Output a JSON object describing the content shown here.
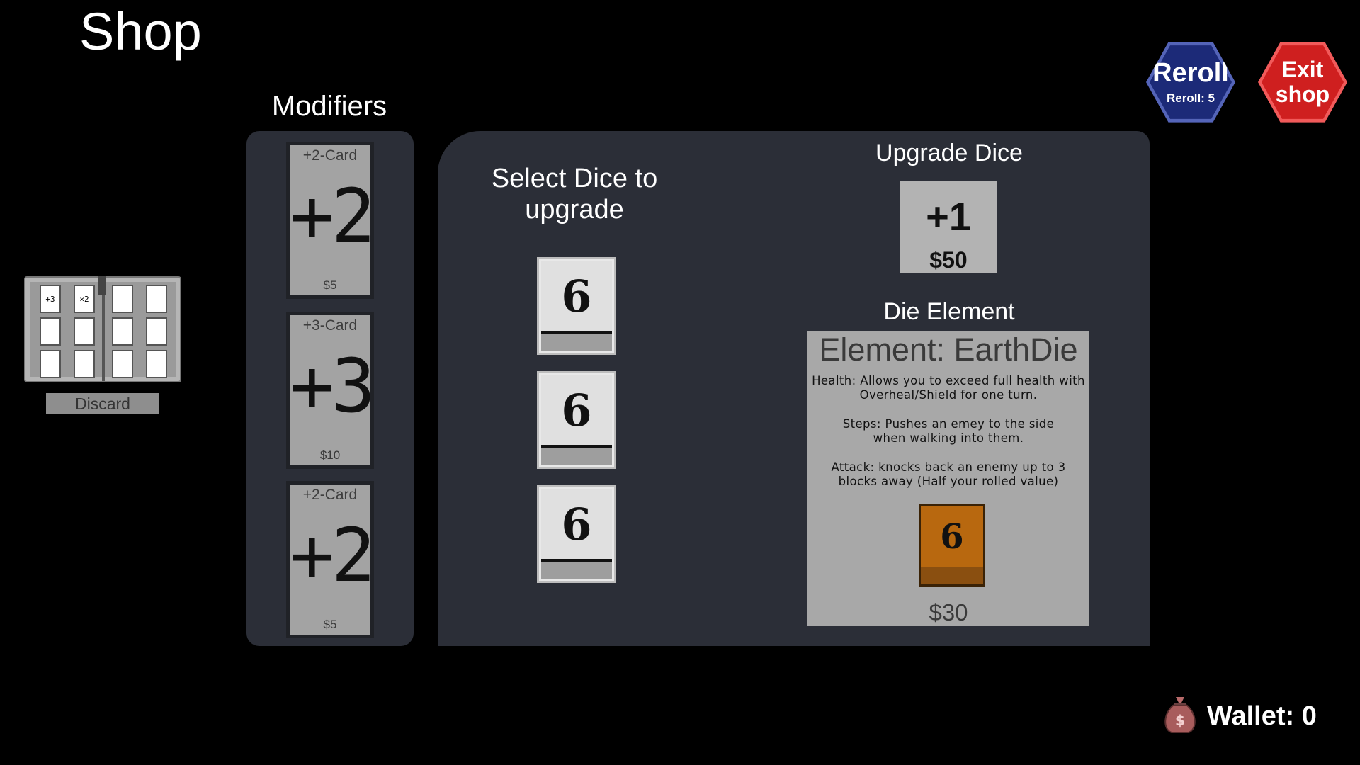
{
  "title": "Shop",
  "deck": {
    "slots": [
      "+3",
      "×2",
      "",
      "",
      "",
      "",
      "",
      "",
      "",
      "",
      "",
      ""
    ],
    "discard_label": "Discard"
  },
  "modifiers": {
    "title": "Modifiers",
    "cards": [
      {
        "title": "+2-Card",
        "value": "+2",
        "price": "$5"
      },
      {
        "title": "+3-Card",
        "value": "+3",
        "price": "$10"
      },
      {
        "title": "+2-Card",
        "value": "+2",
        "price": "$5"
      }
    ]
  },
  "select_dice": {
    "title": "Select Dice to upgrade",
    "dice": [
      "6",
      "6",
      "6"
    ]
  },
  "upgrade": {
    "title": "Upgrade Dice",
    "value": "+1",
    "price": "$50"
  },
  "element": {
    "title": "Die Element",
    "name": "Element: EarthDie",
    "health": "Health: Allows you to exceed full health with Overheal/Shield for one turn.",
    "steps": "Steps: Pushes an emey to the side when walking into them.",
    "attack": "Attack: knocks back an enemy up to 3 blocks away (Half your rolled value)",
    "die_value": "6",
    "price": "$30",
    "die_color": "#b8680f"
  },
  "reroll": {
    "label": "Reroll",
    "sub": "Reroll: 5",
    "color": "#1c2a78"
  },
  "exit": {
    "label_line1": "Exit",
    "label_line2": "shop",
    "color": "#cf1f1f"
  },
  "wallet": {
    "label": "Wallet: 0",
    "icon": "money-bag-icon"
  }
}
